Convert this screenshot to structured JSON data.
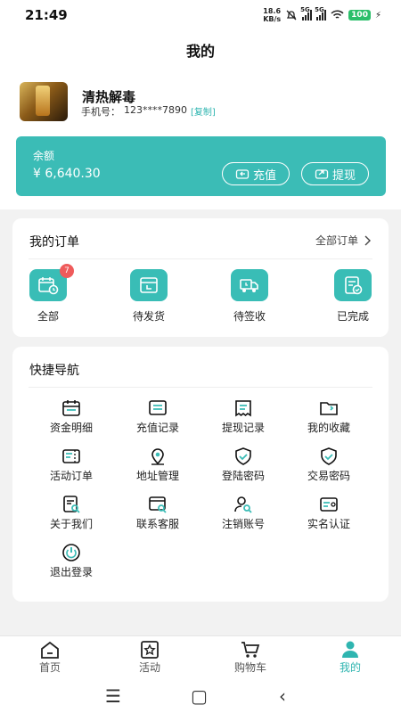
{
  "status": {
    "time": "21:49",
    "net_speed_value": "18.6",
    "net_speed_unit": "KB/s",
    "sig1": "5G",
    "sig2": "5G",
    "battery": "100"
  },
  "header": {
    "title": "我的"
  },
  "user": {
    "name": "清热解毒",
    "phone_label": "手机号：",
    "phone": "123****7890",
    "copy_label": "[复制]"
  },
  "balance": {
    "label": "余额",
    "amount": "¥ 6,640.30",
    "recharge_label": "充值",
    "withdraw_label": "提现"
  },
  "orders": {
    "title": "我的订单",
    "all_label": "全部订单",
    "items": [
      {
        "label": "全部",
        "icon": "calendar-clock-icon",
        "badge": "7"
      },
      {
        "label": "待发货",
        "icon": "box-icon"
      },
      {
        "label": "待签收",
        "icon": "truck-clock-icon"
      },
      {
        "label": "已完成",
        "icon": "document-check-icon"
      }
    ]
  },
  "shortcuts": {
    "title": "快捷导航",
    "items": [
      {
        "label": "资金明细",
        "icon": "calendar-icon"
      },
      {
        "label": "充值记录",
        "icon": "list-card-icon"
      },
      {
        "label": "提现记录",
        "icon": "receipt-icon"
      },
      {
        "label": "我的收藏",
        "icon": "folder-icon"
      },
      {
        "label": "活动订单",
        "icon": "ticket-icon"
      },
      {
        "label": "地址管理",
        "icon": "location-icon"
      },
      {
        "label": "登陆密码",
        "icon": "shield-check-icon"
      },
      {
        "label": "交易密码",
        "icon": "shield-check-icon"
      },
      {
        "label": "关于我们",
        "icon": "doc-search-icon"
      },
      {
        "label": "联系客服",
        "icon": "card-search-icon"
      },
      {
        "label": "注销账号",
        "icon": "user-search-icon"
      },
      {
        "label": "实名认证",
        "icon": "id-card-icon"
      },
      {
        "label": "退出登录",
        "icon": "power-icon"
      }
    ]
  },
  "tabs": [
    {
      "label": "首页",
      "icon": "home-icon"
    },
    {
      "label": "活动",
      "icon": "activity-star-icon"
    },
    {
      "label": "购物车",
      "icon": "cart-icon"
    },
    {
      "label": "我的",
      "icon": "user-icon"
    }
  ],
  "colors": {
    "accent": "#3bbcb6",
    "badge": "#ef5b5b",
    "active_tab": "#2fb5b0"
  }
}
